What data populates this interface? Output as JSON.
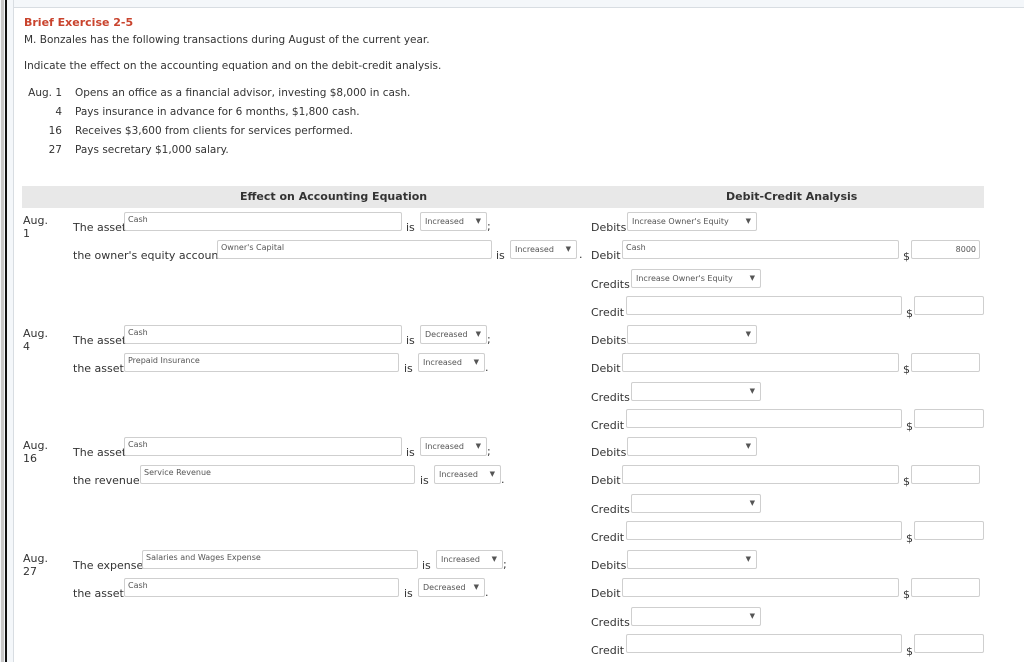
{
  "exercise": {
    "title": "Brief Exercise 2-5",
    "intro": "M. Bonzales has the following transactions during August of the current year.",
    "instruction": "Indicate the effect on the accounting equation and on the debit-credit analysis.",
    "transactions": [
      {
        "date": "Aug. 1",
        "text": "Opens an office as a financial advisor, investing $8,000 in cash."
      },
      {
        "date": "4",
        "text": "Pays insurance in advance for 6 months, $1,800 cash."
      },
      {
        "date": "16",
        "text": "Receives $3,600 from clients for services performed."
      },
      {
        "date": "27",
        "text": "Pays secretary $1,000 salary."
      }
    ]
  },
  "headers": {
    "effect": "Effect on Accounting Equation",
    "debit_credit": "Debit-Credit Analysis"
  },
  "labels": {
    "is": "is",
    "semicolon": ";",
    "period": ".",
    "debits": "Debits",
    "debit": "Debit",
    "credits": "Credits",
    "credit": "Credit",
    "dollar": "$",
    "arrow": "▼"
  },
  "entries": [
    {
      "date": "Aug. 1",
      "line1": {
        "prefix": "The asset",
        "account": "Cash",
        "effect": "Increased"
      },
      "line2": {
        "prefix": "the owner's equity account",
        "account": "Owner's Capital",
        "effect": "Increased"
      },
      "debits_select": "Increase Owner's Equity",
      "debit_account": "Cash",
      "debit_amount": "8000",
      "credits_select": "Increase Owner's Equity",
      "credit_account": "",
      "credit_amount": ""
    },
    {
      "date": "Aug. 4",
      "line1": {
        "prefix": "The asset",
        "account": "Cash",
        "effect": "Decreased"
      },
      "line2": {
        "prefix": "the asset",
        "account": "Prepaid Insurance",
        "effect": "Increased"
      },
      "debits_select": "",
      "debit_account": "",
      "debit_amount": "",
      "credits_select": "",
      "credit_account": "",
      "credit_amount": ""
    },
    {
      "date": "Aug. 16",
      "line1": {
        "prefix": "The asset",
        "account": "Cash",
        "effect": "Increased"
      },
      "line2": {
        "prefix": "the revenue",
        "account": "Service Revenue",
        "effect": "Increased"
      },
      "debits_select": "",
      "debit_account": "",
      "debit_amount": "",
      "credits_select": "",
      "credit_account": "",
      "credit_amount": ""
    },
    {
      "date": "Aug. 27",
      "line1": {
        "prefix": "The expense",
        "account": "Salaries and Wages Expense",
        "effect": "Increased"
      },
      "line2": {
        "prefix": "the asset",
        "account": "Cash",
        "effect": "Decreased"
      },
      "debits_select": "",
      "debit_account": "",
      "debit_amount": "",
      "credits_select": "",
      "credit_account": "",
      "credit_amount": ""
    }
  ]
}
